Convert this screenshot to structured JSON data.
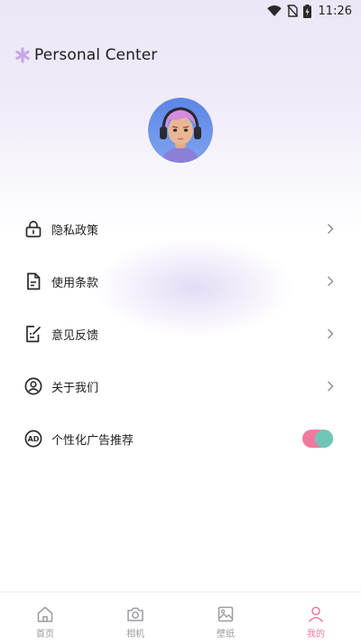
{
  "status_bar": {
    "time": "11:26",
    "icons": [
      "wifi-icon",
      "no-sim-icon",
      "battery-charging-icon"
    ]
  },
  "header": {
    "title": "Personal Center",
    "icon": "asterisk-flower-icon",
    "icon_color": "#c9a8ea"
  },
  "avatar": {
    "icon": "avatar-headphones",
    "ring_color": "#6d8ee8"
  },
  "menu": {
    "items": [
      {
        "label": "隐私政策",
        "icon": "lock-icon",
        "action": "chevron"
      },
      {
        "label": "使用条款",
        "icon": "document-icon",
        "action": "chevron"
      },
      {
        "label": "意见反馈",
        "icon": "edit-note-icon",
        "action": "chevron"
      },
      {
        "label": "关于我们",
        "icon": "user-circle-icon",
        "action": "chevron"
      },
      {
        "label": "个性化广告推荐",
        "icon": "ad-icon",
        "action": "toggle",
        "toggle_on": true
      }
    ]
  },
  "tabbar": {
    "tabs": [
      {
        "label": "首页",
        "icon": "home-icon",
        "active": false
      },
      {
        "label": "相机",
        "icon": "camera-icon",
        "active": false
      },
      {
        "label": "壁纸",
        "icon": "image-icon",
        "active": false
      },
      {
        "label": "我的",
        "icon": "person-icon",
        "active": true
      }
    ]
  },
  "colors": {
    "accent": "#f07a9e",
    "toggle_knob": "#6fc6b6",
    "inactive_tab": "#9a9aa2"
  }
}
